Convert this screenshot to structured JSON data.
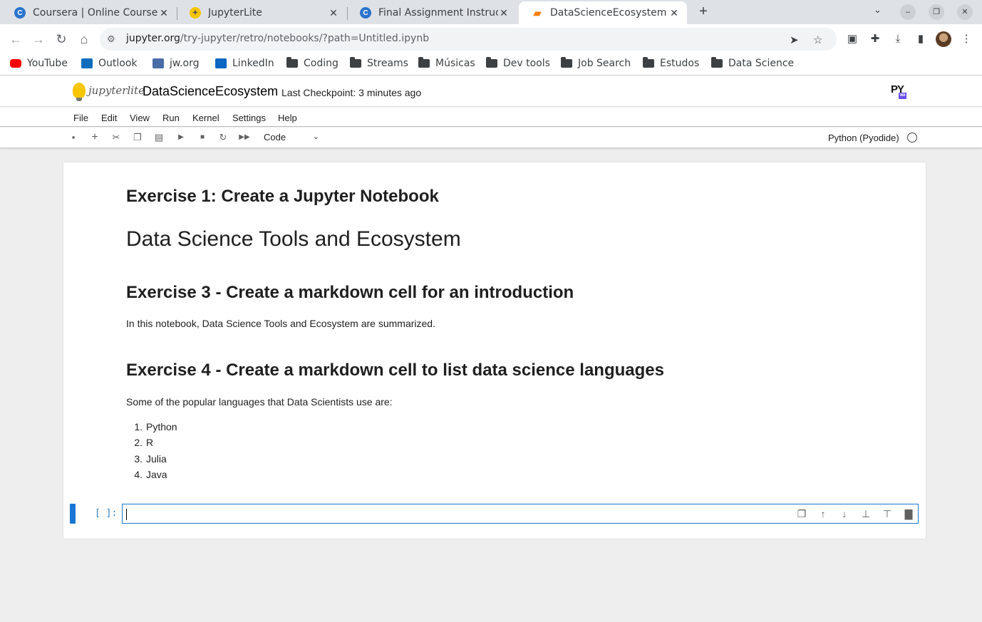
{
  "browser": {
    "tabs": [
      {
        "title": "Coursera | Online Courses",
        "icon": "coursera-icon",
        "close": "✕"
      },
      {
        "title": "JupyterLite",
        "icon": "jupyterlite-icon",
        "close": "✕"
      },
      {
        "title": "Final Assignment Instruct",
        "icon": "coursera-icon",
        "close": "✕"
      },
      {
        "title": "DataScienceEcosystem",
        "icon": "notebook-icon",
        "close": "✕"
      }
    ],
    "new_tab": "+",
    "url_host": "jupyter.org",
    "url_path": "/try-jupyter/retro/notebooks/?path=Untitled.ipynb",
    "bookmarks": [
      {
        "label": "YouTube",
        "icon": "youtube-icon",
        "color": "#ff0000"
      },
      {
        "label": "Outlook",
        "icon": "outlook-icon",
        "color": "#0f6cbd"
      },
      {
        "label": "jw.org",
        "icon": "jw-icon",
        "color": "#4a6da7"
      },
      {
        "label": "LinkedIn",
        "icon": "linkedin-icon",
        "color": "#0a66c2"
      },
      {
        "label": "Coding",
        "icon": "folder-icon"
      },
      {
        "label": "Streams",
        "icon": "folder-icon"
      },
      {
        "label": "Músicas",
        "icon": "folder-icon"
      },
      {
        "label": "Dev tools",
        "icon": "folder-icon"
      },
      {
        "label": "Job Search",
        "icon": "folder-icon"
      },
      {
        "label": "Estudos",
        "icon": "folder-icon"
      },
      {
        "label": "Data Science",
        "icon": "folder-icon"
      }
    ]
  },
  "jupyter": {
    "logo_text": "jupyterlite",
    "notebook_title": "DataScienceEcosystem",
    "checkpoint": "Last Checkpoint: 3 minutes ago",
    "pyodide_logo": "PY",
    "pyodide_badge": "WA",
    "menus": [
      "File",
      "Edit",
      "View",
      "Run",
      "Kernel",
      "Settings",
      "Help"
    ],
    "cell_type": "Code",
    "kernel": "Python (Pyodide)"
  },
  "notebook": {
    "h_ex1": "Exercise 1: Create a Jupyter Notebook",
    "h_title": "Data Science Tools and Ecosystem",
    "h_ex3": "Exercise 3 - Create a markdown cell for an introduction",
    "p_intro": "In this notebook, Data Science Tools and Ecosystem are summarized.",
    "h_ex4": "Exercise 4 - Create a markdown cell to list data science languages",
    "p_languages": "Some of the popular languages that Data Scientists use are:",
    "languages": [
      {
        "num": "1.",
        "name": "Python"
      },
      {
        "num": "2.",
        "name": "R"
      },
      {
        "num": "3.",
        "name": "Julia"
      },
      {
        "num": "4.",
        "name": "Java"
      }
    ],
    "prompt": "[ ]:"
  },
  "colors": {
    "accent": "#1976d2",
    "prompt": "#307fc1",
    "tabstrip": "#dee1e6"
  }
}
